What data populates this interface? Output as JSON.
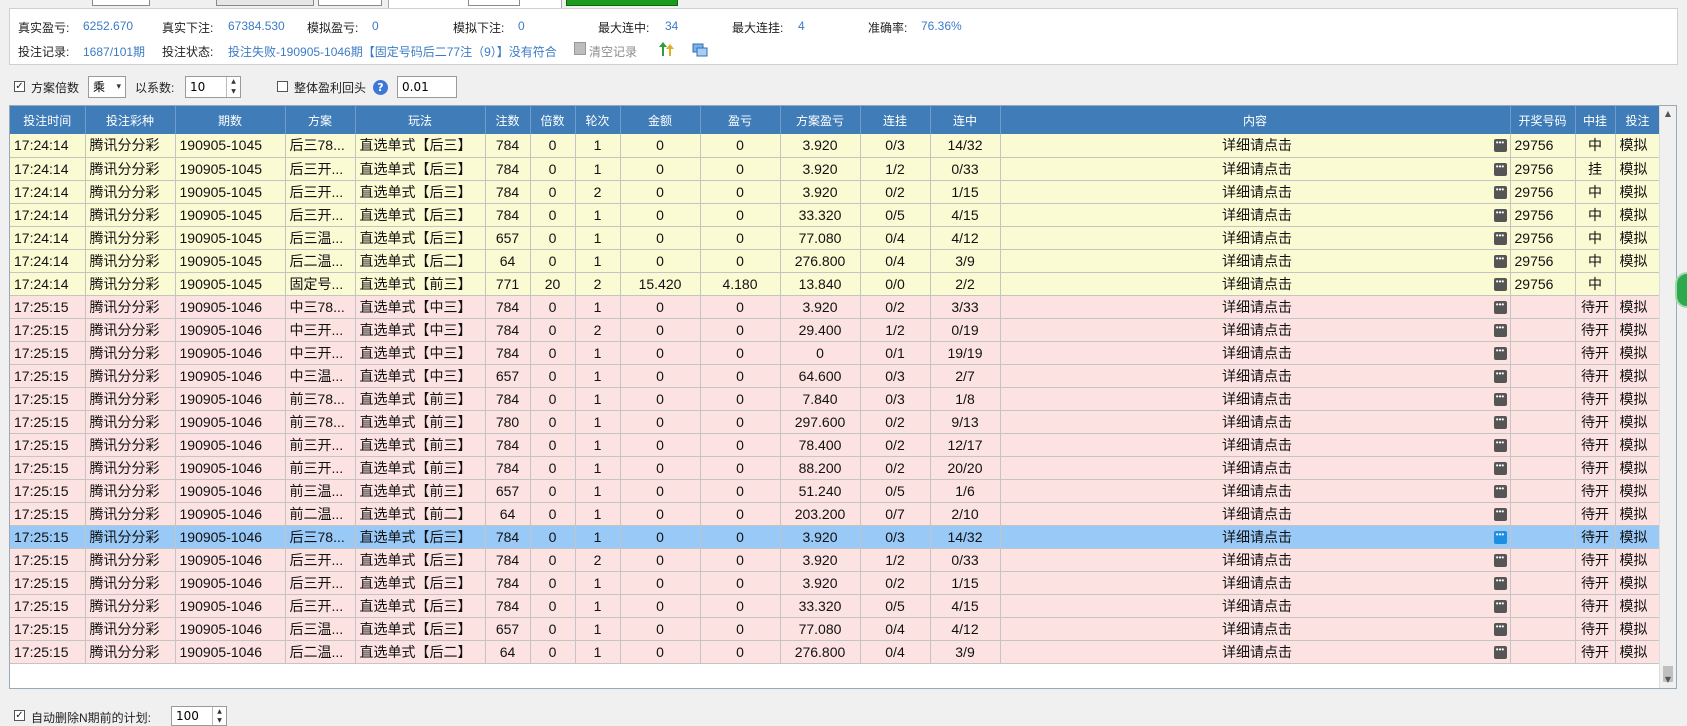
{
  "stats": {
    "real_profit_label": "真实盈亏:",
    "real_profit": "6252.670",
    "real_bet_label": "真实下注:",
    "real_bet": "67384.530",
    "sim_profit_label": "模拟盈亏:",
    "sim_profit": "0",
    "sim_bet_label": "模拟下注:",
    "sim_bet": "0",
    "max_win_label": "最大连中:",
    "max_win": "34",
    "max_loss_label": "最大连挂:",
    "max_loss": "4",
    "accuracy_label": "准确率:",
    "accuracy": "76.36%",
    "record_label": "投注记录:",
    "record": "1687/101期",
    "status_label": "投注状态:",
    "status": "投注失败-190905-1046期【固定号码后二77注（9）】没有符合",
    "clear_record": "清空记录"
  },
  "options": {
    "plan_multiplier_label": "方案倍数",
    "plan_multiplier_checked": true,
    "operator": "乘",
    "coef_label": "以系数:",
    "coef_value": "10",
    "overall_rollback_label": "整体盈利回头",
    "overall_rollback_checked": false,
    "rollback_value": "0.01"
  },
  "table": {
    "headers": [
      "投注时间",
      "投注彩种",
      "期数",
      "方案",
      "玩法",
      "注数",
      "倍数",
      "轮次",
      "金额",
      "盈亏",
      "方案盈亏",
      "连挂",
      "连中",
      "内容",
      "开奖号码",
      "中挂",
      "投注"
    ],
    "detail_text": "详细请点击",
    "rows": [
      {
        "time": "17:24:14",
        "lottery": "腾讯分分彩",
        "period": "190905-1045",
        "plan": "后三78...",
        "play": "直选单式【后三】",
        "count": "784",
        "mult": "0",
        "round": "1",
        "amount": "0",
        "pl": "0",
        "pl_color": "red",
        "plan_pl": "3.920",
        "plan_pl_color": "red",
        "losses": "0/3",
        "wins": "14/32",
        "draw": "29756",
        "hit": "中",
        "mode": "模拟",
        "style": "yellow"
      },
      {
        "time": "17:24:14",
        "lottery": "腾讯分分彩",
        "period": "190905-1045",
        "plan": "后三开...",
        "play": "直选单式【后三】",
        "count": "784",
        "mult": "0",
        "round": "1",
        "amount": "0",
        "pl": "0",
        "pl_color": "blue",
        "plan_pl": "3.920",
        "plan_pl_color": "red",
        "losses": "1/2",
        "wins": "0/33",
        "draw": "29756",
        "hit": "挂",
        "mode": "模拟",
        "style": "yellow"
      },
      {
        "time": "17:24:14",
        "lottery": "腾讯分分彩",
        "period": "190905-1045",
        "plan": "后三开...",
        "play": "直选单式【后三】",
        "count": "784",
        "mult": "0",
        "round": "2",
        "amount": "0",
        "pl": "0",
        "pl_color": "red",
        "plan_pl": "3.920",
        "plan_pl_color": "red",
        "losses": "0/2",
        "wins": "1/15",
        "draw": "29756",
        "hit": "中",
        "mode": "模拟",
        "style": "yellow"
      },
      {
        "time": "17:24:14",
        "lottery": "腾讯分分彩",
        "period": "190905-1045",
        "plan": "后三开...",
        "play": "直选单式【后三】",
        "count": "784",
        "mult": "0",
        "round": "1",
        "amount": "0",
        "pl": "0",
        "pl_color": "red",
        "plan_pl": "33.320",
        "plan_pl_color": "red",
        "losses": "0/5",
        "wins": "4/15",
        "draw": "29756",
        "hit": "中",
        "mode": "模拟",
        "style": "yellow"
      },
      {
        "time": "17:24:14",
        "lottery": "腾讯分分彩",
        "period": "190905-1045",
        "plan": "后三温...",
        "play": "直选单式【后三】",
        "count": "657",
        "mult": "0",
        "round": "1",
        "amount": "0",
        "pl": "0",
        "pl_color": "red",
        "plan_pl": "77.080",
        "plan_pl_color": "red",
        "losses": "0/4",
        "wins": "4/12",
        "draw": "29756",
        "hit": "中",
        "mode": "模拟",
        "style": "yellow"
      },
      {
        "time": "17:24:14",
        "lottery": "腾讯分分彩",
        "period": "190905-1045",
        "plan": "后二温...",
        "play": "直选单式【后二】",
        "count": "64",
        "mult": "0",
        "round": "1",
        "amount": "0",
        "pl": "0",
        "pl_color": "red",
        "plan_pl": "276.800",
        "plan_pl_color": "red",
        "losses": "0/4",
        "wins": "3/9",
        "draw": "29756",
        "hit": "中",
        "mode": "模拟",
        "style": "yellow"
      },
      {
        "time": "17:24:14",
        "lottery": "腾讯分分彩",
        "period": "190905-1045",
        "plan": "固定号...",
        "play": "直选单式【前三】",
        "count": "771",
        "mult": "20",
        "round": "2",
        "amount": "15.420",
        "pl": "4.180",
        "pl_color": "red",
        "plan_pl": "13.840",
        "plan_pl_color": "red",
        "losses": "0/0",
        "wins": "2/2",
        "draw": "29756",
        "hit": "中",
        "mode": "",
        "style": "yellow"
      },
      {
        "time": "17:25:15",
        "lottery": "腾讯分分彩",
        "period": "190905-1046",
        "plan": "中三78...",
        "play": "直选单式【中三】",
        "count": "784",
        "mult": "0",
        "round": "1",
        "amount": "0",
        "pl": "0",
        "pl_color": "",
        "plan_pl": "3.920",
        "plan_pl_color": "red",
        "losses": "0/2",
        "wins": "3/33",
        "draw": "",
        "hit": "待开",
        "mode": "模拟",
        "style": "pink"
      },
      {
        "time": "17:25:15",
        "lottery": "腾讯分分彩",
        "period": "190905-1046",
        "plan": "中三开...",
        "play": "直选单式【中三】",
        "count": "784",
        "mult": "0",
        "round": "2",
        "amount": "0",
        "pl": "0",
        "pl_color": "",
        "plan_pl": "29.400",
        "plan_pl_color": "red",
        "losses": "1/2",
        "wins": "0/19",
        "draw": "",
        "hit": "待开",
        "mode": "模拟",
        "style": "pink"
      },
      {
        "time": "17:25:15",
        "lottery": "腾讯分分彩",
        "period": "190905-1046",
        "plan": "中三开...",
        "play": "直选单式【中三】",
        "count": "784",
        "mult": "0",
        "round": "1",
        "amount": "0",
        "pl": "0",
        "pl_color": "",
        "plan_pl": "0",
        "plan_pl_color": "blue",
        "losses": "0/1",
        "wins": "19/19",
        "draw": "",
        "hit": "待开",
        "mode": "模拟",
        "style": "pink"
      },
      {
        "time": "17:25:15",
        "lottery": "腾讯分分彩",
        "period": "190905-1046",
        "plan": "中三温...",
        "play": "直选单式【中三】",
        "count": "657",
        "mult": "0",
        "round": "1",
        "amount": "0",
        "pl": "0",
        "pl_color": "",
        "plan_pl": "64.600",
        "plan_pl_color": "red",
        "losses": "0/3",
        "wins": "2/7",
        "draw": "",
        "hit": "待开",
        "mode": "模拟",
        "style": "pink"
      },
      {
        "time": "17:25:15",
        "lottery": "腾讯分分彩",
        "period": "190905-1046",
        "plan": "前三78...",
        "play": "直选单式【前三】",
        "count": "784",
        "mult": "0",
        "round": "1",
        "amount": "0",
        "pl": "0",
        "pl_color": "",
        "plan_pl": "7.840",
        "plan_pl_color": "red",
        "losses": "0/3",
        "wins": "1/8",
        "draw": "",
        "hit": "待开",
        "mode": "模拟",
        "style": "pink"
      },
      {
        "time": "17:25:15",
        "lottery": "腾讯分分彩",
        "period": "190905-1046",
        "plan": "前三78...",
        "play": "直选单式【前三】",
        "count": "780",
        "mult": "0",
        "round": "1",
        "amount": "0",
        "pl": "0",
        "pl_color": "",
        "plan_pl": "297.600",
        "plan_pl_color": "red",
        "losses": "0/2",
        "wins": "9/13",
        "draw": "",
        "hit": "待开",
        "mode": "模拟",
        "style": "pink"
      },
      {
        "time": "17:25:15",
        "lottery": "腾讯分分彩",
        "period": "190905-1046",
        "plan": "前三开...",
        "play": "直选单式【前三】",
        "count": "784",
        "mult": "0",
        "round": "1",
        "amount": "0",
        "pl": "0",
        "pl_color": "",
        "plan_pl": "78.400",
        "plan_pl_color": "red",
        "losses": "0/2",
        "wins": "12/17",
        "draw": "",
        "hit": "待开",
        "mode": "模拟",
        "style": "pink"
      },
      {
        "time": "17:25:15",
        "lottery": "腾讯分分彩",
        "period": "190905-1046",
        "plan": "前三开...",
        "play": "直选单式【前三】",
        "count": "784",
        "mult": "0",
        "round": "1",
        "amount": "0",
        "pl": "0",
        "pl_color": "",
        "plan_pl": "88.200",
        "plan_pl_color": "red",
        "losses": "0/2",
        "wins": "20/20",
        "draw": "",
        "hit": "待开",
        "mode": "模拟",
        "style": "pink"
      },
      {
        "time": "17:25:15",
        "lottery": "腾讯分分彩",
        "period": "190905-1046",
        "plan": "前三温...",
        "play": "直选单式【前三】",
        "count": "657",
        "mult": "0",
        "round": "1",
        "amount": "0",
        "pl": "0",
        "pl_color": "",
        "plan_pl": "51.240",
        "plan_pl_color": "red",
        "losses": "0/5",
        "wins": "1/6",
        "draw": "",
        "hit": "待开",
        "mode": "模拟",
        "style": "pink"
      },
      {
        "time": "17:25:15",
        "lottery": "腾讯分分彩",
        "period": "190905-1046",
        "plan": "前二温...",
        "play": "直选单式【前二】",
        "count": "64",
        "mult": "0",
        "round": "1",
        "amount": "0",
        "pl": "0",
        "pl_color": "",
        "plan_pl": "203.200",
        "plan_pl_color": "red",
        "losses": "0/7",
        "wins": "2/10",
        "draw": "",
        "hit": "待开",
        "mode": "模拟",
        "style": "pink"
      },
      {
        "time": "17:25:15",
        "lottery": "腾讯分分彩",
        "period": "190905-1046",
        "plan": "后三78...",
        "play": "直选单式【后三】",
        "count": "784",
        "mult": "0",
        "round": "1",
        "amount": "0",
        "pl": "0",
        "pl_color": "",
        "plan_pl": "3.920",
        "plan_pl_color": "red",
        "losses": "0/3",
        "wins": "14/32",
        "draw": "",
        "hit": "待开",
        "mode": "模拟",
        "style": "sel"
      },
      {
        "time": "17:25:15",
        "lottery": "腾讯分分彩",
        "period": "190905-1046",
        "plan": "后三开...",
        "play": "直选单式【后三】",
        "count": "784",
        "mult": "0",
        "round": "2",
        "amount": "0",
        "pl": "0",
        "pl_color": "",
        "plan_pl": "3.920",
        "plan_pl_color": "red",
        "losses": "1/2",
        "wins": "0/33",
        "draw": "",
        "hit": "待开",
        "mode": "模拟",
        "style": "pink"
      },
      {
        "time": "17:25:15",
        "lottery": "腾讯分分彩",
        "period": "190905-1046",
        "plan": "后三开...",
        "play": "直选单式【后三】",
        "count": "784",
        "mult": "0",
        "round": "1",
        "amount": "0",
        "pl": "0",
        "pl_color": "",
        "plan_pl": "3.920",
        "plan_pl_color": "red",
        "losses": "0/2",
        "wins": "1/15",
        "draw": "",
        "hit": "待开",
        "mode": "模拟",
        "style": "pink"
      },
      {
        "time": "17:25:15",
        "lottery": "腾讯分分彩",
        "period": "190905-1046",
        "plan": "后三开...",
        "play": "直选单式【后三】",
        "count": "784",
        "mult": "0",
        "round": "1",
        "amount": "0",
        "pl": "0",
        "pl_color": "",
        "plan_pl": "33.320",
        "plan_pl_color": "red",
        "losses": "0/5",
        "wins": "4/15",
        "draw": "",
        "hit": "待开",
        "mode": "模拟",
        "style": "pink"
      },
      {
        "time": "17:25:15",
        "lottery": "腾讯分分彩",
        "period": "190905-1046",
        "plan": "后三温...",
        "play": "直选单式【后三】",
        "count": "657",
        "mult": "0",
        "round": "1",
        "amount": "0",
        "pl": "0",
        "pl_color": "",
        "plan_pl": "77.080",
        "plan_pl_color": "red",
        "losses": "0/4",
        "wins": "4/12",
        "draw": "",
        "hit": "待开",
        "mode": "模拟",
        "style": "pink"
      },
      {
        "time": "17:25:15",
        "lottery": "腾讯分分彩",
        "period": "190905-1046",
        "plan": "后二温...",
        "play": "直选单式【后二】",
        "count": "64",
        "mult": "0",
        "round": "1",
        "amount": "0",
        "pl": "0",
        "pl_color": "",
        "plan_pl": "276.800",
        "plan_pl_color": "red",
        "losses": "0/4",
        "wins": "3/9",
        "draw": "",
        "hit": "待开",
        "mode": "模拟",
        "style": "pink"
      }
    ]
  },
  "bottom": {
    "auto_delete_label": "自动删除N期前的计划:",
    "auto_delete_checked": true,
    "auto_delete_value": "100"
  },
  "colors": {
    "header_bg": "#3f7cb8",
    "row_yellow": "#fafad3",
    "row_pink": "#fde2e2",
    "row_selected": "#99c9f7",
    "value_blue": "#3b7bc6",
    "loss_red": "#d41e1e"
  }
}
